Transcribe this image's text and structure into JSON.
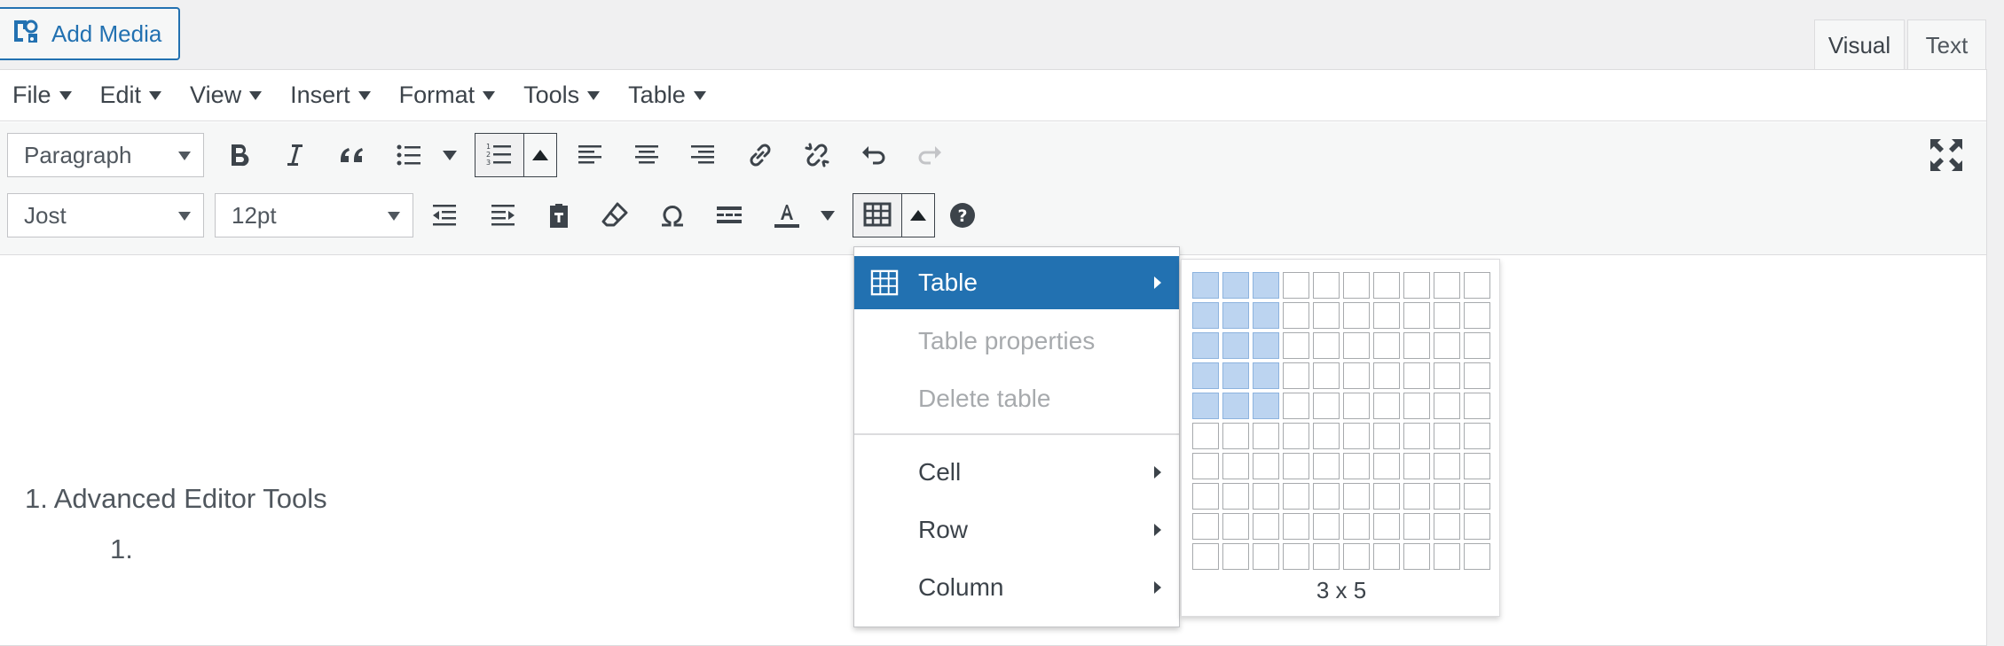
{
  "add_media": {
    "label": "Add Media"
  },
  "mode_tabs": {
    "visual": "Visual",
    "text": "Text"
  },
  "menubar": {
    "items": [
      {
        "label": "File"
      },
      {
        "label": "Edit"
      },
      {
        "label": "View"
      },
      {
        "label": "Insert"
      },
      {
        "label": "Format"
      },
      {
        "label": "Tools"
      },
      {
        "label": "Table"
      }
    ]
  },
  "toolbar": {
    "format_select": "Paragraph",
    "font_select": "Jost",
    "size_select": "12pt"
  },
  "content": {
    "list_item_1": "1. Advanced Editor Tools",
    "list_item_2": "1."
  },
  "table_menu": {
    "items": [
      {
        "label": "Table",
        "state": "highlighted",
        "has_submenu": true
      },
      {
        "label": "Table properties",
        "state": "disabled"
      },
      {
        "label": "Delete table",
        "state": "disabled"
      },
      {
        "label": "Cell",
        "has_submenu": true
      },
      {
        "label": "Row",
        "has_submenu": true
      },
      {
        "label": "Column",
        "has_submenu": true
      }
    ]
  },
  "grid_picker": {
    "columns": 10,
    "rows": 10,
    "selected_cols": 3,
    "selected_rows": 5,
    "label": "3 x 5"
  },
  "colors": {
    "accent": "#2271b1",
    "selected_cell": "#bcd4f0",
    "disabled_text": "#a7aaad"
  }
}
